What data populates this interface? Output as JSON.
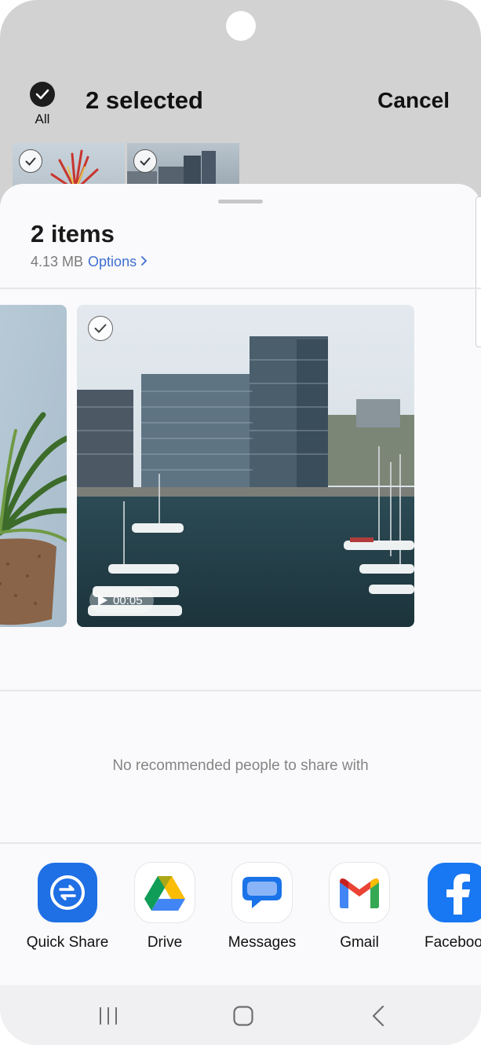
{
  "header": {
    "all_label": "All",
    "selected_title": "2 selected",
    "cancel_label": "Cancel"
  },
  "sheet": {
    "title": "2 items",
    "size": "4.13 MB",
    "options_label": "Options",
    "video_duration": "00:05",
    "no_recommended": "No recommended people to share with"
  },
  "apps": [
    {
      "label": "Quick Share",
      "icon": "quick-share-icon"
    },
    {
      "label": "Drive",
      "icon": "google-drive-icon"
    },
    {
      "label": "Messages",
      "icon": "messages-icon"
    },
    {
      "label": "Gmail",
      "icon": "gmail-icon"
    },
    {
      "label": "Facebook",
      "icon": "facebook-icon"
    }
  ],
  "nav": {
    "recents_icon": "recents-icon",
    "home_icon": "home-icon",
    "back_icon": "back-icon"
  },
  "colors": {
    "accent_link": "#3e6fd0",
    "quick_share": "#1f6fe5",
    "facebook": "#1877f2",
    "header_bg": "#d2d2d2",
    "sheet_bg": "#fafafc"
  }
}
